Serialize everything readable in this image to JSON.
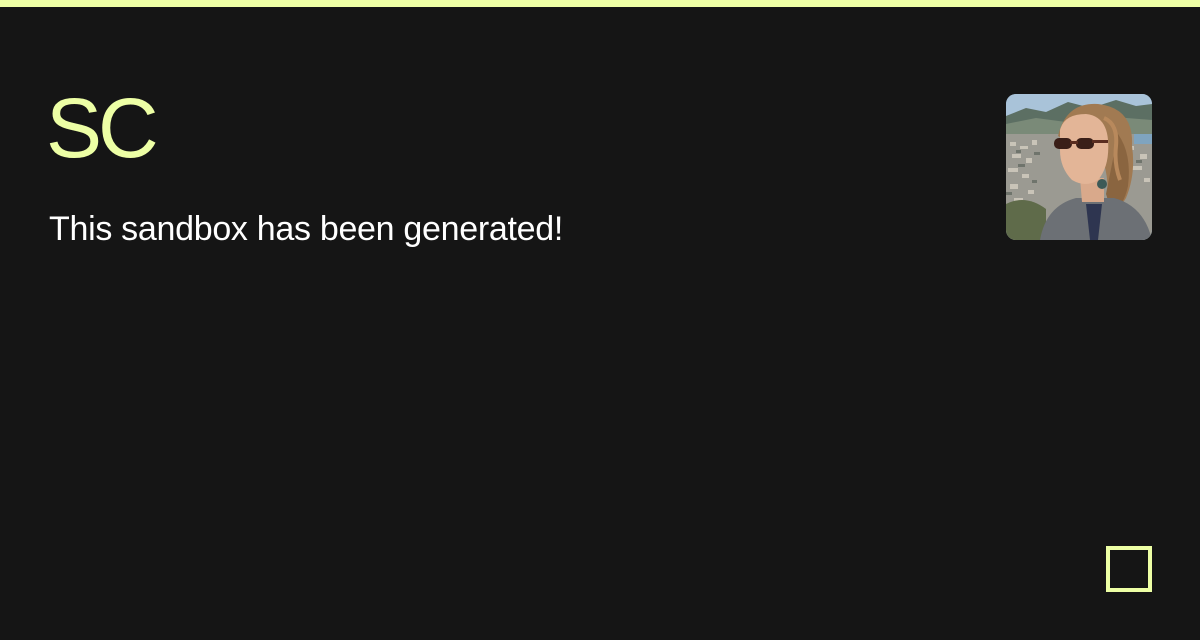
{
  "card": {
    "title": "SC",
    "description": "This sandbox has been generated!"
  },
  "avatar": {
    "alt": "Profile photo of a person wearing sunglasses in front of a hillside city view"
  },
  "logo": {
    "icon": "square-logo-icon"
  },
  "colors": {
    "background": "#151515",
    "accent": "#EDFFA5",
    "text": "#FFFFFF"
  }
}
